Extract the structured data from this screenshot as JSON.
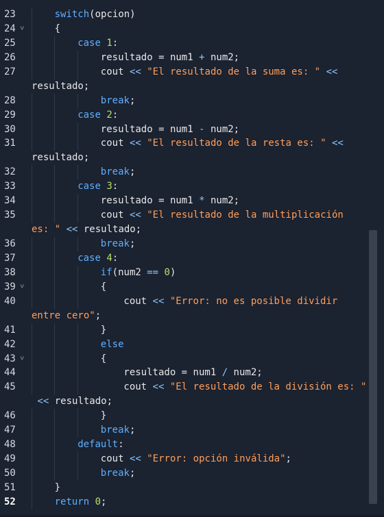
{
  "editor": {
    "current_line": "52",
    "lines": [
      {
        "n": "23",
        "fold": false,
        "indent": 1,
        "segs": [
          [
            "kw",
            "switch"
          ],
          [
            "txt",
            "(opcion)"
          ]
        ]
      },
      {
        "n": "24",
        "fold": true,
        "indent": 1,
        "segs": [
          [
            "txt",
            "{"
          ]
        ]
      },
      {
        "n": "25",
        "fold": false,
        "indent": 2,
        "segs": [
          [
            "kw",
            "case "
          ],
          [
            "num",
            "1"
          ],
          [
            "txt",
            ":"
          ]
        ]
      },
      {
        "n": "26",
        "fold": false,
        "indent": 3,
        "segs": [
          [
            "txt",
            "resultado = num1 "
          ],
          [
            "op",
            "+"
          ],
          [
            "txt",
            " num2;"
          ]
        ]
      },
      {
        "n": "27",
        "fold": false,
        "indent": 3,
        "segs": [
          [
            "txt",
            "cout "
          ],
          [
            "op",
            "<<"
          ],
          [
            "txt",
            " "
          ],
          [
            "str",
            "\"El resultado de la suma es: \""
          ],
          [
            "txt",
            " "
          ],
          [
            "op",
            "<<"
          ]
        ]
      },
      {
        "n": "",
        "fold": false,
        "indent": 0,
        "segs": [
          [
            "txt",
            "resultado;"
          ]
        ]
      },
      {
        "n": "28",
        "fold": false,
        "indent": 3,
        "segs": [
          [
            "kw",
            "break"
          ],
          [
            "txt",
            ";"
          ]
        ]
      },
      {
        "n": "29",
        "fold": false,
        "indent": 2,
        "segs": [
          [
            "kw",
            "case "
          ],
          [
            "num",
            "2"
          ],
          [
            "txt",
            ":"
          ]
        ]
      },
      {
        "n": "30",
        "fold": false,
        "indent": 3,
        "segs": [
          [
            "txt",
            "resultado = num1 "
          ],
          [
            "op",
            "-"
          ],
          [
            "txt",
            " num2;"
          ]
        ]
      },
      {
        "n": "31",
        "fold": false,
        "indent": 3,
        "segs": [
          [
            "txt",
            "cout "
          ],
          [
            "op",
            "<<"
          ],
          [
            "txt",
            " "
          ],
          [
            "str",
            "\"El resultado de la resta es: \""
          ],
          [
            "txt",
            " "
          ],
          [
            "op",
            "<<"
          ]
        ]
      },
      {
        "n": "",
        "fold": false,
        "indent": 0,
        "segs": [
          [
            "txt",
            "resultado;"
          ]
        ]
      },
      {
        "n": "32",
        "fold": false,
        "indent": 3,
        "segs": [
          [
            "kw",
            "break"
          ],
          [
            "txt",
            ";"
          ]
        ]
      },
      {
        "n": "33",
        "fold": false,
        "indent": 2,
        "segs": [
          [
            "kw",
            "case "
          ],
          [
            "num",
            "3"
          ],
          [
            "txt",
            ":"
          ]
        ]
      },
      {
        "n": "34",
        "fold": false,
        "indent": 3,
        "segs": [
          [
            "txt",
            "resultado = num1 "
          ],
          [
            "op",
            "*"
          ],
          [
            "txt",
            " num2;"
          ]
        ]
      },
      {
        "n": "35",
        "fold": false,
        "indent": 3,
        "segs": [
          [
            "txt",
            "cout "
          ],
          [
            "op",
            "<<"
          ],
          [
            "txt",
            " "
          ],
          [
            "str",
            "\"El resultado de la multiplicación"
          ]
        ]
      },
      {
        "n": "",
        "fold": false,
        "indent": 0,
        "segs": [
          [
            "str",
            "es: \""
          ],
          [
            "txt",
            " "
          ],
          [
            "op",
            "<<"
          ],
          [
            "txt",
            " resultado;"
          ]
        ]
      },
      {
        "n": "36",
        "fold": false,
        "indent": 3,
        "segs": [
          [
            "kw",
            "break"
          ],
          [
            "txt",
            ";"
          ]
        ]
      },
      {
        "n": "37",
        "fold": false,
        "indent": 2,
        "segs": [
          [
            "kw",
            "case "
          ],
          [
            "num",
            "4"
          ],
          [
            "txt",
            ":"
          ]
        ]
      },
      {
        "n": "38",
        "fold": false,
        "indent": 3,
        "segs": [
          [
            "kw",
            "if"
          ],
          [
            "txt",
            "(num2 "
          ],
          [
            "op",
            "=="
          ],
          [
            "txt",
            " "
          ],
          [
            "num",
            "0"
          ],
          [
            "txt",
            ")"
          ]
        ]
      },
      {
        "n": "39",
        "fold": true,
        "indent": 3,
        "segs": [
          [
            "txt",
            "{"
          ]
        ]
      },
      {
        "n": "40",
        "fold": false,
        "indent": 4,
        "segs": [
          [
            "txt",
            "cout "
          ],
          [
            "op",
            "<<"
          ],
          [
            "txt",
            " "
          ],
          [
            "str",
            "\"Error: no es posible dividir"
          ]
        ]
      },
      {
        "n": "",
        "fold": false,
        "indent": 0,
        "segs": [
          [
            "str",
            "entre cero\""
          ],
          [
            "txt",
            ";"
          ]
        ]
      },
      {
        "n": "41",
        "fold": false,
        "indent": 3,
        "segs": [
          [
            "txt",
            "}"
          ]
        ]
      },
      {
        "n": "42",
        "fold": false,
        "indent": 3,
        "segs": [
          [
            "kw",
            "else"
          ]
        ]
      },
      {
        "n": "43",
        "fold": true,
        "indent": 3,
        "segs": [
          [
            "txt",
            "{"
          ]
        ]
      },
      {
        "n": "44",
        "fold": false,
        "indent": 4,
        "segs": [
          [
            "txt",
            "resultado = num1 "
          ],
          [
            "op",
            "/"
          ],
          [
            "txt",
            " num2;"
          ]
        ]
      },
      {
        "n": "45",
        "fold": false,
        "indent": 4,
        "segs": [
          [
            "txt",
            "cout "
          ],
          [
            "op",
            "<<"
          ],
          [
            "txt",
            " "
          ],
          [
            "str",
            "\"El resultado de la división es: \""
          ]
        ]
      },
      {
        "n": "",
        "fold": false,
        "indent": 0,
        "segs": [
          [
            "txt",
            " "
          ],
          [
            "op",
            "<<"
          ],
          [
            "txt",
            " resultado;"
          ]
        ]
      },
      {
        "n": "46",
        "fold": false,
        "indent": 3,
        "segs": [
          [
            "txt",
            "}"
          ]
        ]
      },
      {
        "n": "47",
        "fold": false,
        "indent": 3,
        "segs": [
          [
            "kw",
            "break"
          ],
          [
            "txt",
            ";"
          ]
        ]
      },
      {
        "n": "48",
        "fold": false,
        "indent": 2,
        "segs": [
          [
            "kw",
            "default"
          ],
          [
            "txt",
            ":"
          ]
        ]
      },
      {
        "n": "49",
        "fold": false,
        "indent": 3,
        "segs": [
          [
            "txt",
            "cout "
          ],
          [
            "op",
            "<<"
          ],
          [
            "txt",
            " "
          ],
          [
            "str",
            "\"Error: opción inválida\""
          ],
          [
            "txt",
            ";"
          ]
        ]
      },
      {
        "n": "50",
        "fold": false,
        "indent": 3,
        "segs": [
          [
            "kw",
            "break"
          ],
          [
            "txt",
            ";"
          ]
        ]
      },
      {
        "n": "51",
        "fold": false,
        "indent": 1,
        "segs": [
          [
            "txt",
            "}"
          ]
        ]
      },
      {
        "n": "52",
        "fold": false,
        "indent": 1,
        "segs": [
          [
            "kw",
            "return "
          ],
          [
            "num",
            "0"
          ],
          [
            "txt",
            ";"
          ]
        ]
      }
    ]
  },
  "icons": {
    "fold": "chevron-down-icon"
  },
  "colors": {
    "background": "#1b2230",
    "keyword": "#5fb0ff",
    "number": "#b5e06b",
    "string": "#ff9f5a",
    "operator": "#8fc7ff",
    "text": "#e8e8e8"
  }
}
